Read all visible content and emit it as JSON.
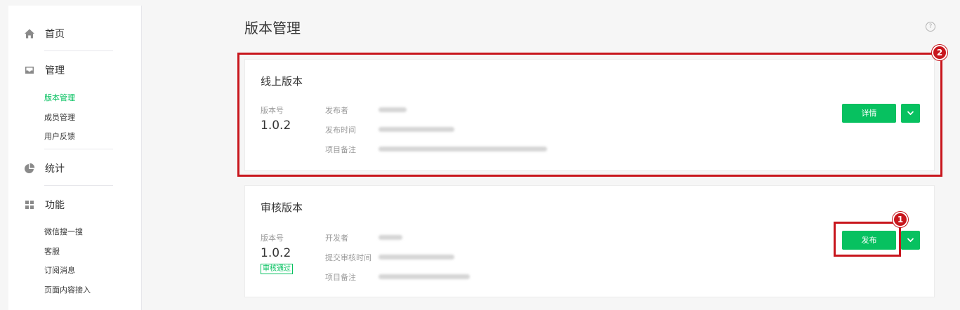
{
  "sidebar": {
    "home": {
      "label": "首页",
      "icon": "home-icon"
    },
    "manage": {
      "label": "管理",
      "icon": "tray-icon",
      "items": [
        {
          "label": "版本管理",
          "active": true
        },
        {
          "label": "成员管理",
          "active": false
        },
        {
          "label": "用户反馈",
          "active": false
        }
      ]
    },
    "stats": {
      "label": "统计",
      "icon": "pie-chart-icon"
    },
    "features": {
      "label": "功能",
      "icon": "grid-icon",
      "items": [
        {
          "label": "微信搜一搜"
        },
        {
          "label": "客服"
        },
        {
          "label": "订阅消息"
        },
        {
          "label": "页面内容接入"
        }
      ]
    }
  },
  "page": {
    "title": "版本管理",
    "help_icon": "question-icon",
    "help_glyph": "?"
  },
  "online": {
    "title": "线上版本",
    "version_label": "版本号",
    "version": "1.0.2",
    "meta_keys": [
      "发布者",
      "发布时间",
      "项目备注"
    ],
    "detail_button": "详情"
  },
  "review": {
    "title": "审核版本",
    "version_label": "版本号",
    "version": "1.0.2",
    "status": "审核通过",
    "meta_keys": [
      "开发者",
      "提交审核时间",
      "项目备注"
    ],
    "publish_button": "发布"
  },
  "annotations": {
    "box1": "1",
    "box2": "2"
  },
  "colors": {
    "accent": "#07c160",
    "highlight": "#c8161d"
  }
}
